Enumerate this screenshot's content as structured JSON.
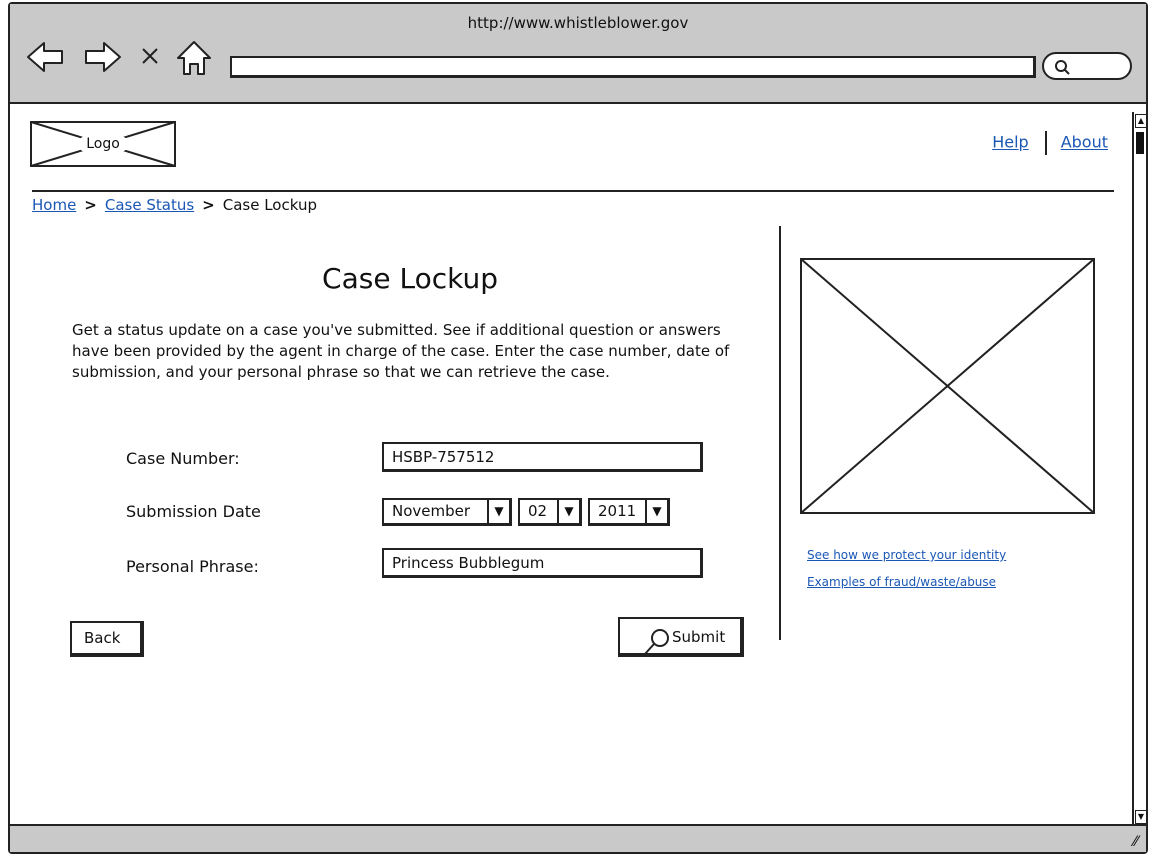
{
  "browser": {
    "url": "http://www.whistleblower.gov",
    "address_value": "",
    "icons": [
      "back-arrow-icon",
      "forward-arrow-icon",
      "close-icon",
      "home-icon",
      "search-icon"
    ]
  },
  "header": {
    "logo_label": "Logo",
    "links": {
      "help": "Help",
      "about": "About"
    }
  },
  "breadcrumb": {
    "home": "Home",
    "case_status": "Case Status",
    "current": "Case Lockup",
    "separator": ">"
  },
  "main": {
    "title": "Case Lockup",
    "intro": "Get a status update on a case you've submitted.  See if additional question or answers have been provided by the agent in charge of the case.  Enter the case number, date of submission, and your personal phrase so that we can retrieve the case.",
    "form": {
      "case_number_label": "Case Number:",
      "case_number_value": "HSBP-757512",
      "submission_date_label": "Submission Date",
      "month": "November",
      "day": "02",
      "year": "2011",
      "personal_phrase_label": "Personal Phrase:",
      "personal_phrase_value": "Princess Bubblegum"
    },
    "buttons": {
      "back": "Back",
      "submit": "Submit"
    }
  },
  "sidebar": {
    "links": [
      "See how we protect your identity",
      "Examples of fraud/waste/abuse"
    ]
  }
}
